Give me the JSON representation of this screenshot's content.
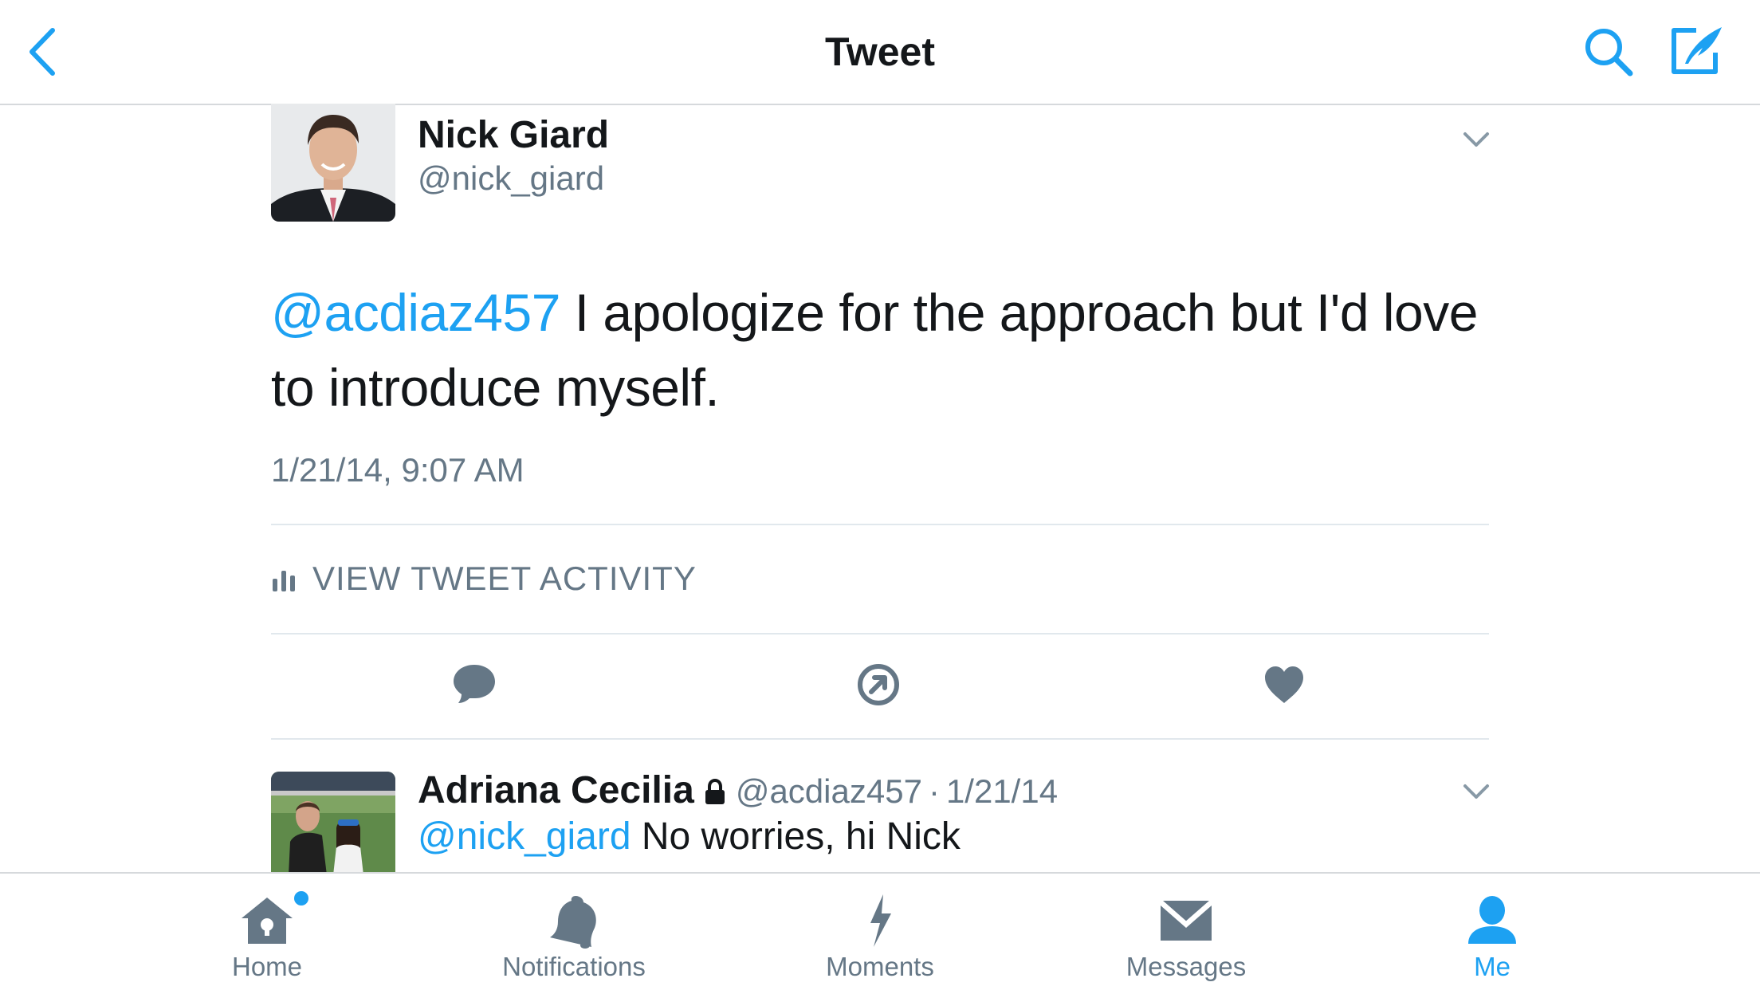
{
  "nav": {
    "title": "Tweet",
    "back_icon": "chevron-left-icon",
    "search_icon": "search-icon",
    "compose_icon": "compose-tweet-icon"
  },
  "tweet": {
    "author_name": "Nick Giard",
    "author_handle": "@nick_giard",
    "mention": "@acdiaz457",
    "text": " I apologize for the approach but I'd love to introduce myself.",
    "timestamp": "1/21/14, 9:07 AM",
    "activity_label": "VIEW TWEET ACTIVITY",
    "actions": [
      "reply-icon",
      "retweet-icon",
      "like-icon"
    ]
  },
  "reply": {
    "author_name": "Adriana Cecilia",
    "author_handle": "@acdiaz457",
    "separator": "·",
    "date": "1/21/14",
    "mention": "@nick_giard",
    "text": " No worries, hi Nick"
  },
  "tabbar": {
    "tabs": [
      {
        "label": "Home",
        "icon": "home-icon"
      },
      {
        "label": "Notifications",
        "icon": "bell-icon"
      },
      {
        "label": "Moments",
        "icon": "lightning-icon"
      },
      {
        "label": "Messages",
        "icon": "envelope-icon"
      },
      {
        "label": "Me",
        "icon": "person-icon"
      }
    ],
    "active_tab": "Me"
  },
  "colors": {
    "accent": "#1da1f2",
    "icon_gray": "#657786",
    "text": "#14171a",
    "divider": "#e1e8ed"
  }
}
